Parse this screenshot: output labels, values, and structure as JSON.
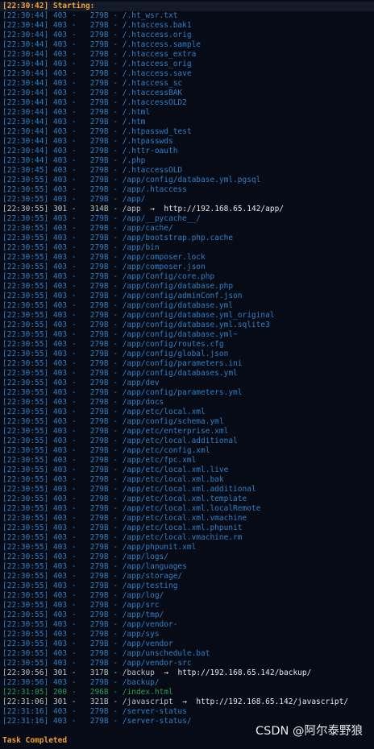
{
  "header": "[22:30:42] Starting:",
  "footer": "Task Completed",
  "watermark": "CSDN @阿尔泰野狼",
  "arrow_glyph": "→",
  "rows": [
    {
      "ts": "[22:30:44]",
      "code": "403",
      "size": "279B",
      "path": "/.ht_wsr.txt"
    },
    {
      "ts": "[22:30:44]",
      "code": "403",
      "size": "279B",
      "path": "/.htaccess.bak1"
    },
    {
      "ts": "[22:30:44]",
      "code": "403",
      "size": "279B",
      "path": "/.htaccess.orig"
    },
    {
      "ts": "[22:30:44]",
      "code": "403",
      "size": "279B",
      "path": "/.htaccess.sample"
    },
    {
      "ts": "[22:30:44]",
      "code": "403",
      "size": "279B",
      "path": "/.htaccess_extra"
    },
    {
      "ts": "[22:30:44]",
      "code": "403",
      "size": "279B",
      "path": "/.htaccess_orig"
    },
    {
      "ts": "[22:30:44]",
      "code": "403",
      "size": "279B",
      "path": "/.htaccess.save"
    },
    {
      "ts": "[22:30:44]",
      "code": "403",
      "size": "279B",
      "path": "/.htaccess_sc"
    },
    {
      "ts": "[22:30:44]",
      "code": "403",
      "size": "279B",
      "path": "/.htaccessBAK"
    },
    {
      "ts": "[22:30:44]",
      "code": "403",
      "size": "279B",
      "path": "/.htaccessOLD2"
    },
    {
      "ts": "[22:30:44]",
      "code": "403",
      "size": "279B",
      "path": "/.html"
    },
    {
      "ts": "[22:30:44]",
      "code": "403",
      "size": "279B",
      "path": "/.htm"
    },
    {
      "ts": "[22:30:44]",
      "code": "403",
      "size": "279B",
      "path": "/.htpasswd_test"
    },
    {
      "ts": "[22:30:44]",
      "code": "403",
      "size": "279B",
      "path": "/.htpasswds"
    },
    {
      "ts": "[22:30:44]",
      "code": "403",
      "size": "279B",
      "path": "/.httr-oauth"
    },
    {
      "ts": "[22:30:44]",
      "code": "403",
      "size": "279B",
      "path": "/.php"
    },
    {
      "ts": "[22:30:45]",
      "code": "403",
      "size": "279B",
      "path": "/.htaccessOLD"
    },
    {
      "ts": "[22:30:55]",
      "code": "403",
      "size": "279B",
      "path": "/app/config/database.yml.pgsql"
    },
    {
      "ts": "[22:30:55]",
      "code": "403",
      "size": "279B",
      "path": "/app/.htaccess"
    },
    {
      "ts": "[22:30:55]",
      "code": "403",
      "size": "279B",
      "path": "/app/"
    },
    {
      "ts": "[22:30:55]",
      "code": "301",
      "size": "314B",
      "path": "/app",
      "redirect": "http://192.168.65.142/app/"
    },
    {
      "ts": "[22:30:55]",
      "code": "403",
      "size": "279B",
      "path": "/app/__pycache__/"
    },
    {
      "ts": "[22:30:55]",
      "code": "403",
      "size": "279B",
      "path": "/app/cache/"
    },
    {
      "ts": "[22:30:55]",
      "code": "403",
      "size": "279B",
      "path": "/app/bootstrap.php.cache"
    },
    {
      "ts": "[22:30:55]",
      "code": "403",
      "size": "279B",
      "path": "/app/bin"
    },
    {
      "ts": "[22:30:55]",
      "code": "403",
      "size": "279B",
      "path": "/app/composer.lock"
    },
    {
      "ts": "[22:30:55]",
      "code": "403",
      "size": "279B",
      "path": "/app/composer.json"
    },
    {
      "ts": "[22:30:55]",
      "code": "403",
      "size": "279B",
      "path": "/app/Config/core.php"
    },
    {
      "ts": "[22:30:55]",
      "code": "403",
      "size": "279B",
      "path": "/app/Config/database.php"
    },
    {
      "ts": "[22:30:55]",
      "code": "403",
      "size": "279B",
      "path": "/app/config/adminConf.json"
    },
    {
      "ts": "[22:30:55]",
      "code": "403",
      "size": "279B",
      "path": "/app/config/database.yml"
    },
    {
      "ts": "[22:30:55]",
      "code": "403",
      "size": "279B",
      "path": "/app/config/database.yml_original"
    },
    {
      "ts": "[22:30:55]",
      "code": "403",
      "size": "279B",
      "path": "/app/config/database.yml.sqlite3"
    },
    {
      "ts": "[22:30:55]",
      "code": "403",
      "size": "279B",
      "path": "/app/config/database.yml~"
    },
    {
      "ts": "[22:30:55]",
      "code": "403",
      "size": "279B",
      "path": "/app/config/routes.cfg"
    },
    {
      "ts": "[22:30:55]",
      "code": "403",
      "size": "279B",
      "path": "/app/config/global.json"
    },
    {
      "ts": "[22:30:55]",
      "code": "403",
      "size": "279B",
      "path": "/app/config/parameters.ini"
    },
    {
      "ts": "[22:30:55]",
      "code": "403",
      "size": "279B",
      "path": "/app/config/databases.yml"
    },
    {
      "ts": "[22:30:55]",
      "code": "403",
      "size": "279B",
      "path": "/app/dev"
    },
    {
      "ts": "[22:30:55]",
      "code": "403",
      "size": "279B",
      "path": "/app/config/parameters.yml"
    },
    {
      "ts": "[22:30:55]",
      "code": "403",
      "size": "279B",
      "path": "/app/docs"
    },
    {
      "ts": "[22:30:55]",
      "code": "403",
      "size": "279B",
      "path": "/app/etc/local.xml"
    },
    {
      "ts": "[22:30:55]",
      "code": "403",
      "size": "279B",
      "path": "/app/config/schema.yml"
    },
    {
      "ts": "[22:30:55]",
      "code": "403",
      "size": "279B",
      "path": "/app/etc/enterprise.xml"
    },
    {
      "ts": "[22:30:55]",
      "code": "403",
      "size": "279B",
      "path": "/app/etc/local.additional"
    },
    {
      "ts": "[22:30:55]",
      "code": "403",
      "size": "279B",
      "path": "/app/etc/config.xml"
    },
    {
      "ts": "[22:30:55]",
      "code": "403",
      "size": "279B",
      "path": "/app/etc/fpc.xml"
    },
    {
      "ts": "[22:30:55]",
      "code": "403",
      "size": "279B",
      "path": "/app/etc/local.xml.live"
    },
    {
      "ts": "[22:30:55]",
      "code": "403",
      "size": "279B",
      "path": "/app/etc/local.xml.bak"
    },
    {
      "ts": "[22:30:55]",
      "code": "403",
      "size": "279B",
      "path": "/app/etc/local.xml.additional"
    },
    {
      "ts": "[22:30:55]",
      "code": "403",
      "size": "279B",
      "path": "/app/etc/local.xml.template"
    },
    {
      "ts": "[22:30:55]",
      "code": "403",
      "size": "279B",
      "path": "/app/etc/local.xml.localRemote"
    },
    {
      "ts": "[22:30:55]",
      "code": "403",
      "size": "279B",
      "path": "/app/etc/local.xml.vmachine"
    },
    {
      "ts": "[22:30:55]",
      "code": "403",
      "size": "279B",
      "path": "/app/etc/local.xml.phpunit"
    },
    {
      "ts": "[22:30:55]",
      "code": "403",
      "size": "279B",
      "path": "/app/etc/local.vmachine.rm"
    },
    {
      "ts": "[22:30:55]",
      "code": "403",
      "size": "279B",
      "path": "/app/phpunit.xml"
    },
    {
      "ts": "[22:30:55]",
      "code": "403",
      "size": "279B",
      "path": "/app/logs/"
    },
    {
      "ts": "[22:30:55]",
      "code": "403",
      "size": "279B",
      "path": "/app/languages"
    },
    {
      "ts": "[22:30:55]",
      "code": "403",
      "size": "279B",
      "path": "/app/storage/"
    },
    {
      "ts": "[22:30:55]",
      "code": "403",
      "size": "279B",
      "path": "/app/testing"
    },
    {
      "ts": "[22:30:55]",
      "code": "403",
      "size": "279B",
      "path": "/app/log/"
    },
    {
      "ts": "[22:30:55]",
      "code": "403",
      "size": "279B",
      "path": "/app/src"
    },
    {
      "ts": "[22:30:55]",
      "code": "403",
      "size": "279B",
      "path": "/app/tmp/"
    },
    {
      "ts": "[22:30:55]",
      "code": "403",
      "size": "279B",
      "path": "/app/vendor-"
    },
    {
      "ts": "[22:30:55]",
      "code": "403",
      "size": "279B",
      "path": "/app/sys"
    },
    {
      "ts": "[22:30:55]",
      "code": "403",
      "size": "279B",
      "path": "/app/vendor"
    },
    {
      "ts": "[22:30:55]",
      "code": "403",
      "size": "279B",
      "path": "/app/unschedule.bat"
    },
    {
      "ts": "[22:30:55]",
      "code": "403",
      "size": "279B",
      "path": "/app/vendor-src"
    },
    {
      "ts": "[22:30:56]",
      "code": "301",
      "size": "317B",
      "path": "/backup",
      "redirect": "http://192.168.65.142/backup/"
    },
    {
      "ts": "[22:30:56]",
      "code": "403",
      "size": "279B",
      "path": "/backup/"
    },
    {
      "ts": "[22:31:05]",
      "code": "200",
      "size": "296B",
      "path": "/index.html"
    },
    {
      "ts": "[22:31:06]",
      "code": "301",
      "size": "321B",
      "path": "/javascript",
      "redirect": "http://192.168.65.142/javascript/"
    },
    {
      "ts": "[22:31:16]",
      "code": "403",
      "size": "279B",
      "path": "/server-status"
    },
    {
      "ts": "[22:31:16]",
      "code": "403",
      "size": "279B",
      "path": "/server-status/"
    }
  ]
}
